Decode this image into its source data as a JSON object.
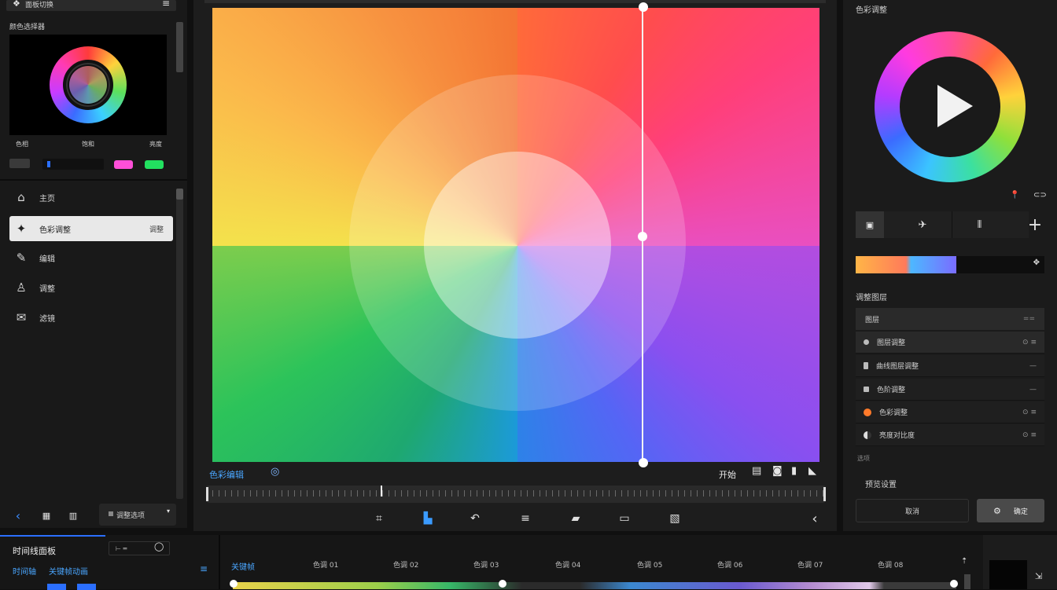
{
  "left_panel": {
    "top_title": "面板切换",
    "preview_title": "颜色选择器",
    "swatch_labels": [
      "色相",
      "饱和",
      "亮度"
    ],
    "swatch_colors": [
      "#ff4fd8",
      "#22e060"
    ],
    "nav_items": [
      {
        "icon": "home-icon",
        "label": "主页"
      },
      {
        "icon": "star-icon",
        "label": "色彩调整",
        "badge": "调整"
      },
      {
        "icon": "edit-icon",
        "label": "编辑"
      },
      {
        "icon": "person-icon",
        "label": "调整"
      },
      {
        "icon": "chat-icon",
        "label": "滤镜"
      }
    ],
    "bottom_select": "调整选项"
  },
  "canvas": {
    "label": "色彩编辑",
    "right_label": "开始",
    "tools": [
      "crop-icon",
      "select-icon",
      "curve-icon",
      "levels-icon",
      "eraser-icon",
      "layers-icon",
      "image-icon"
    ]
  },
  "right_panel": {
    "title": "色彩调整",
    "gradient_colors": [
      "#ffb547",
      "#ff7a5a",
      "#4db8ff",
      "#7a6cff"
    ],
    "section_title": "调整图层",
    "layers_header": "图层",
    "layers": [
      {
        "label": "图层调整",
        "dot": "#bbbbbb"
      },
      {
        "label": "曲线图层调整",
        "dot": "#bbbbbb"
      },
      {
        "label": "色阶调整",
        "dot": "#bbbbbb"
      },
      {
        "label": "色彩调整",
        "dot": "#ff7a2a"
      },
      {
        "label": "亮度对比度",
        "dot": "#dddddd"
      }
    ],
    "sub_label": "选项",
    "footer_label": "预览设置",
    "cancel_label": "取消",
    "ok_label": "确定"
  },
  "timeline": {
    "title": "时间线面板",
    "sub_tabs": [
      "时间轴",
      "关键帧动画"
    ],
    "track_label": "关键帧",
    "ticks": [
      "色调 01",
      "色调 02",
      "色调 03",
      "色调 04",
      "色调 05",
      "色调 06",
      "色调 07",
      "色调 08"
    ]
  }
}
